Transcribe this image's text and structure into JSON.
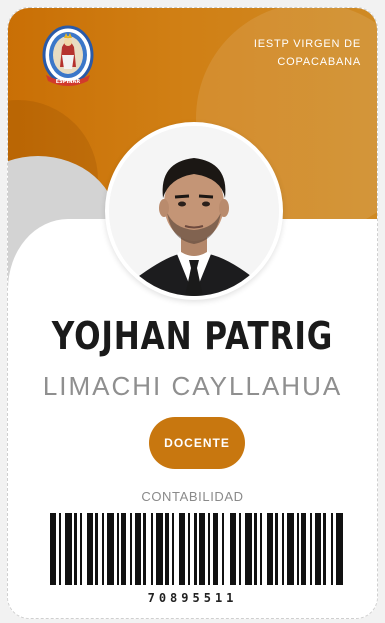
{
  "card": {
    "institution_line1": "IESTP VIRGEN DE",
    "institution_line2": "COPACABANA",
    "first_name": "YOJHAN PATRIG",
    "last_name": "LIMACHI CAYLLAHUA",
    "role": "DOCENTE",
    "program": "CONTABILIDAD",
    "barcode_number": "70895511",
    "logo": {
      "icon": "institution-crest-icon",
      "ribbon_text": "ESPINAR"
    }
  },
  "colors": {
    "brand_orange": "#c96f05",
    "badge": "#c8770f",
    "name": "#1a1a1a",
    "last_name": "#8f8f8f"
  }
}
